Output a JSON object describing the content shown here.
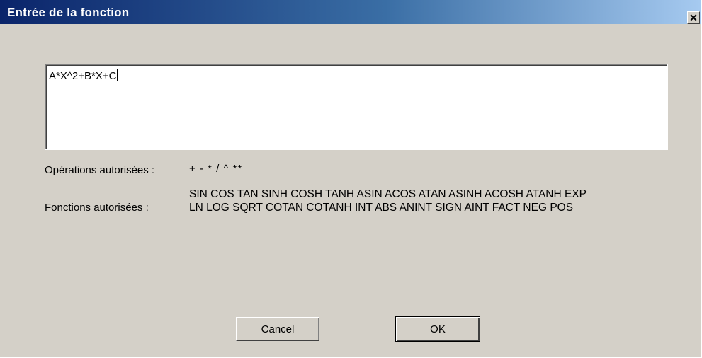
{
  "window": {
    "title": "Entrée de la fonction",
    "close_symbol": "✕"
  },
  "formula": {
    "value": "A*X^2+B*X+C"
  },
  "operations": {
    "label": "Opérations autorisées :",
    "value": "+ - * / ^ **"
  },
  "functions": {
    "label": "Fonctions autorisées :",
    "line1": "SIN COS TAN SINH COSH TANH ASIN ACOS ATAN ASINH ACOSH ATANH EXP",
    "line2": "LN LOG SQRT COTAN COTANH INT ABS ANINT SIGN AINT FACT NEG POS"
  },
  "buttons": {
    "cancel_label": "Cancel",
    "ok_label": "OK"
  },
  "colors": {
    "titlebar_start": "#0a246a",
    "titlebar_end": "#a6caf0",
    "dialog_bg": "#d4d0c8"
  },
  "icons": {
    "close": "close-icon"
  }
}
